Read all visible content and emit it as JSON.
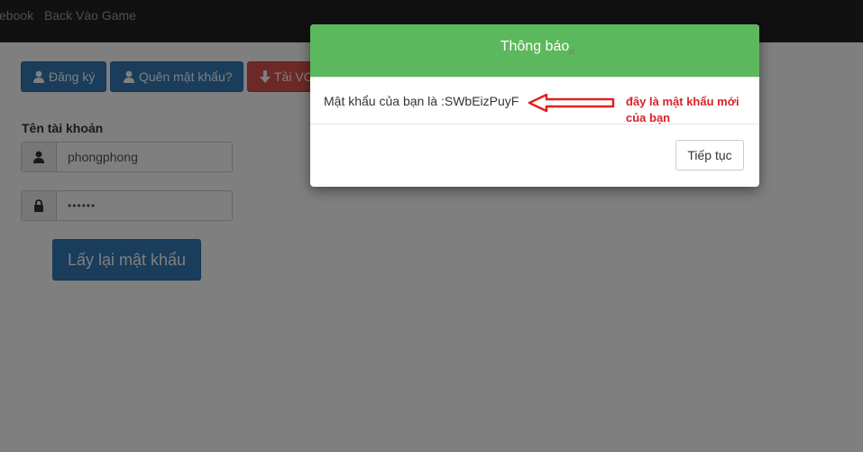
{
  "navbar": {
    "link_facebook": "ebook",
    "link_back": "Back Vào Game"
  },
  "actions": {
    "register_label": "Đăng ký",
    "forgot_label": "Quên mật khẩu?",
    "download_label": "Tải VC"
  },
  "form": {
    "username_label": "Tên tài khoản",
    "username_value": "phongphong",
    "password_value": "••••••",
    "submit_label": "Lấy lại mật khẩu"
  },
  "modal": {
    "title": "Thông báo",
    "close_symbol": "×",
    "message": "Mật khẩu của bạn là :SWbEizPuyF",
    "annotation_line1": "đây là mật khẩu mới",
    "annotation_line2": "của bạn",
    "continue_label": "Tiếp tục"
  },
  "icons": {
    "register": "user-icon",
    "forgot": "user-icon",
    "download": "download-arrow-icon",
    "username": "user-icon",
    "password": "lock-icon",
    "arrow": "red-arrow-left-icon"
  },
  "colors": {
    "navbar": "#222222",
    "primary": "#337ab7",
    "danger": "#d9534f",
    "modal_header": "#5cb85c",
    "annotation": "#d9222a"
  }
}
